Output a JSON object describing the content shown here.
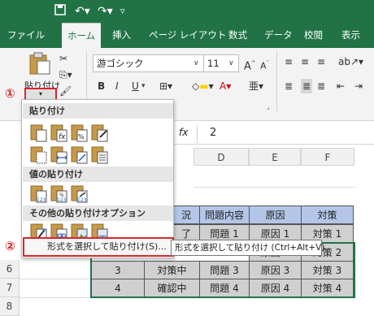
{
  "quick_access": {
    "save_icon": "save-icon",
    "undo_icon": "undo-icon",
    "redo_icon": "redo-icon",
    "customize_icon": "customize-qa-icon"
  },
  "tabs": [
    {
      "label": "ファイル"
    },
    {
      "label": "ホーム"
    },
    {
      "label": "挿入"
    },
    {
      "label": "ページ レイアウト"
    },
    {
      "label": "数式"
    },
    {
      "label": "データ"
    },
    {
      "label": "校閲"
    },
    {
      "label": "表示"
    }
  ],
  "ribbon": {
    "paste_label": "貼り付け",
    "font_name": "游ゴシック",
    "font_size": "11",
    "font_group_label": "ント",
    "bold": "B",
    "italic": "I",
    "underline": "U",
    "font_grow": "A",
    "font_shrink": "A"
  },
  "formula_bar": {
    "fx": "fx",
    "value": "2"
  },
  "columns": [
    "D",
    "E",
    "F"
  ],
  "rows": [
    "6",
    "7",
    "8"
  ],
  "table": {
    "header": [
      "況",
      "問題内容",
      "原因",
      "対策"
    ],
    "row1": [
      "了",
      "問題 1",
      "原因 1",
      "対策 1"
    ],
    "row2": [
      "",
      "",
      "原因 2",
      "対策 2"
    ],
    "row3": [
      "3",
      "対策中",
      "問題 3",
      "原因 3",
      "対策 3"
    ],
    "row4": [
      "4",
      "確認中",
      "問題 4",
      "原因 4",
      "対策 4"
    ]
  },
  "paste_menu": {
    "section_paste": "貼り付け",
    "section_values": "値の貼り付け",
    "section_other": "その他の貼り付けオプション",
    "special_item": "形式を選択して貼り付け(S)...",
    "tooltip": "形式を選択して貼り付け (Ctrl+Alt+V)"
  },
  "markers": {
    "one": "①",
    "two": "②"
  },
  "colors": {
    "brand": "#217346",
    "header_cell": "#b4c6e7",
    "data_cell": "#d0d0d0",
    "marker_red": "#d9262b"
  }
}
